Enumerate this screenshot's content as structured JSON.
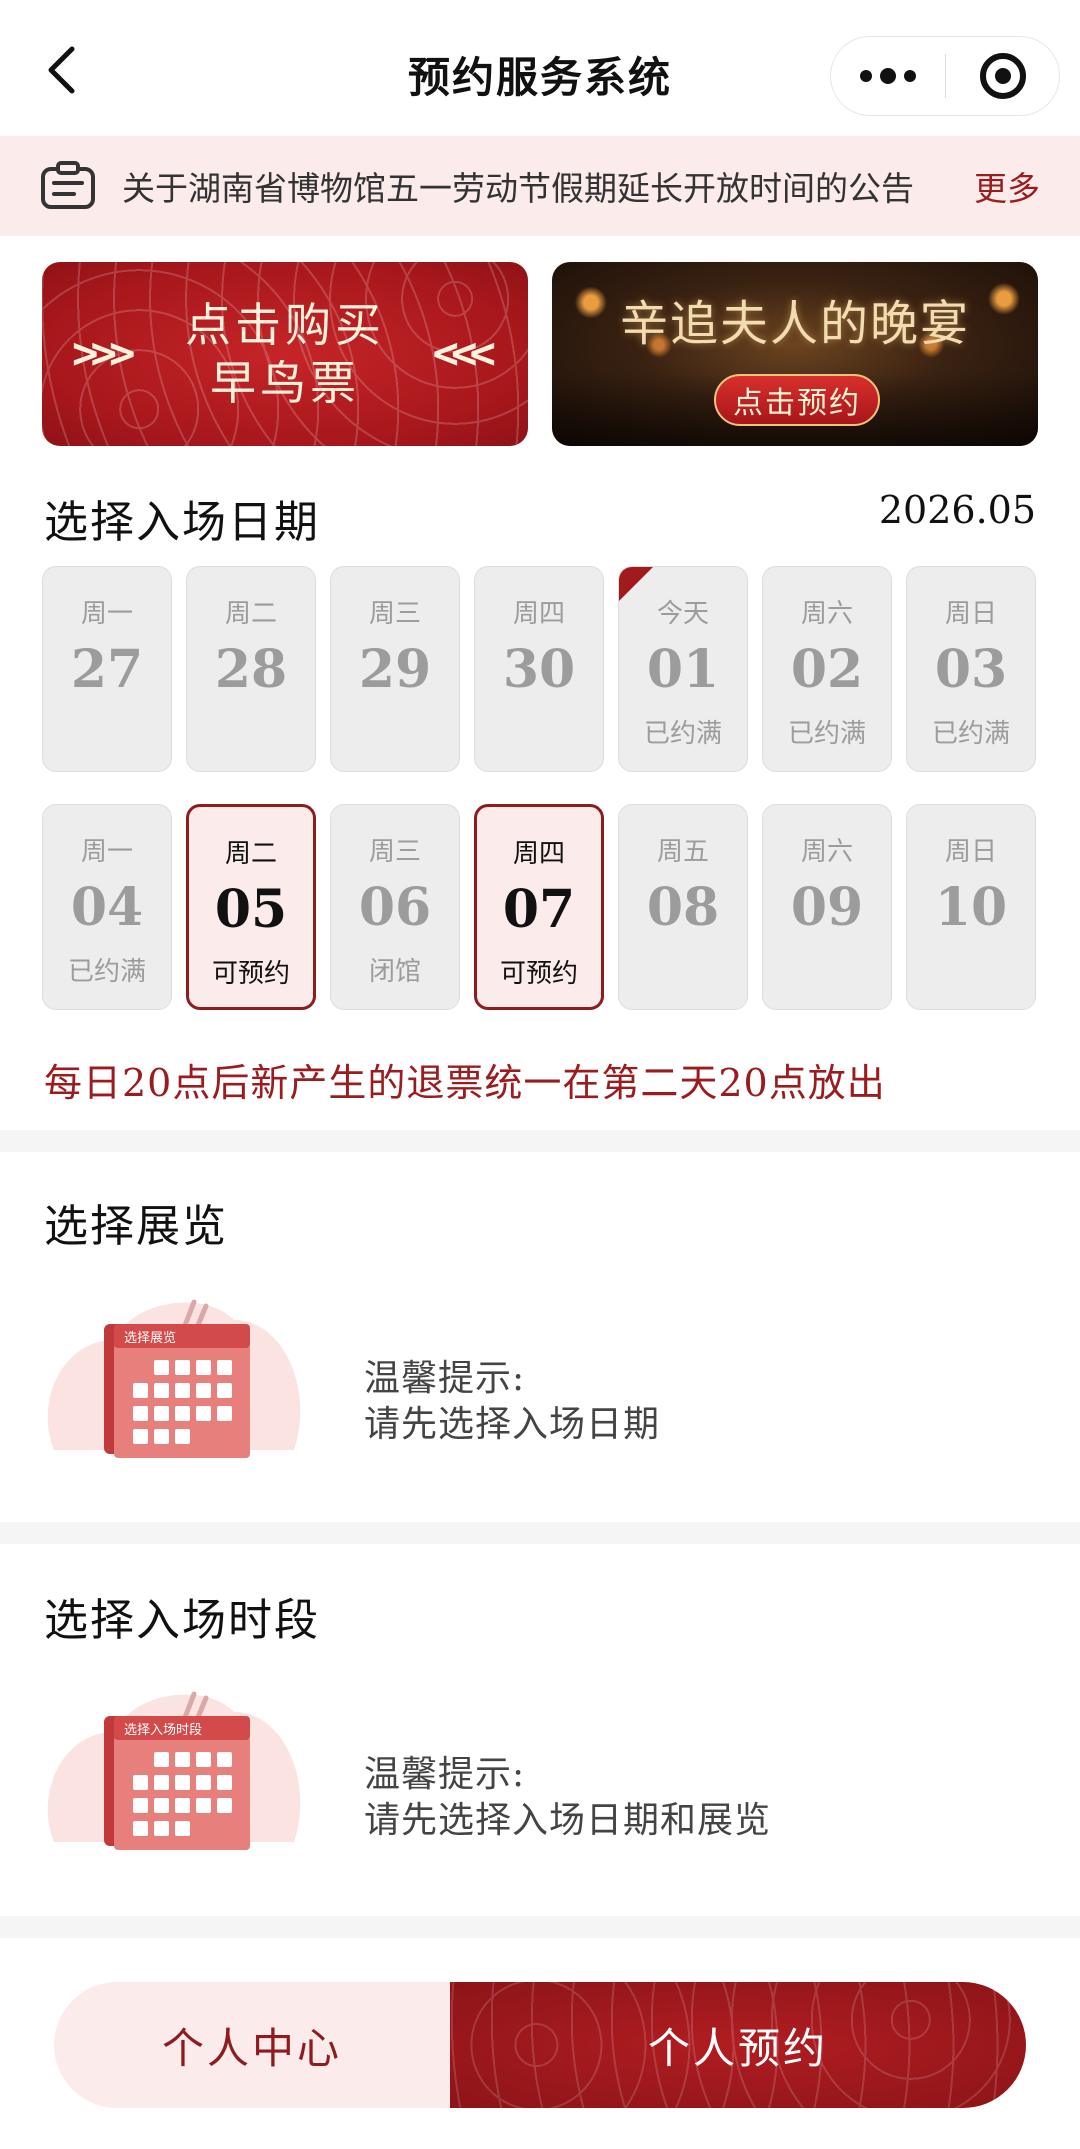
{
  "header": {
    "title": "预约服务系统"
  },
  "notice": {
    "text": "关于湖南省博物馆五一劳动节假期延长开放时间的公告",
    "more": "更多"
  },
  "banners": {
    "early_bird_line1": "点击购买",
    "early_bird_line2": "早鸟票",
    "event_title": "辛追夫人的晚宴",
    "event_button": "点击预约"
  },
  "date_section": {
    "title": "选择入场日期",
    "month": "2026.05",
    "week1": [
      {
        "weekday": "周一",
        "day": "27",
        "status": ""
      },
      {
        "weekday": "周二",
        "day": "28",
        "status": ""
      },
      {
        "weekday": "周三",
        "day": "29",
        "status": ""
      },
      {
        "weekday": "周四",
        "day": "30",
        "status": ""
      },
      {
        "weekday": "今天",
        "day": "01",
        "status": "已约满"
      },
      {
        "weekday": "周六",
        "day": "02",
        "status": "已约满"
      },
      {
        "weekday": "周日",
        "day": "03",
        "status": "已约满"
      }
    ],
    "week2": [
      {
        "weekday": "周一",
        "day": "04",
        "status": "已约满"
      },
      {
        "weekday": "周二",
        "day": "05",
        "status": "可预约"
      },
      {
        "weekday": "周三",
        "day": "06",
        "status": "闭馆"
      },
      {
        "weekday": "周四",
        "day": "07",
        "status": "可预约"
      },
      {
        "weekday": "周五",
        "day": "08",
        "status": ""
      },
      {
        "weekday": "周六",
        "day": "09",
        "status": ""
      },
      {
        "weekday": "周日",
        "day": "10",
        "status": ""
      }
    ],
    "note": "每日20点后新产生的退票统一在第二天20点放出"
  },
  "exhibition_section": {
    "title": "选择展览",
    "illustration_label": "选择展览",
    "tip_title": "温馨提示:",
    "tip_text": "请先选择入场日期"
  },
  "timeslot_section": {
    "title": "选择入场时段",
    "illustration_label": "选择入场时段",
    "tip_title": "温馨提示:",
    "tip_text": "请先选择入场日期和展览"
  },
  "bottom_bar": {
    "personal_center": "个人中心",
    "my_booking": "个人预约"
  },
  "colors": {
    "brand_red": "#9b1c1f",
    "available_bg": "#fbeceb",
    "disabled_bg": "#ededed"
  }
}
